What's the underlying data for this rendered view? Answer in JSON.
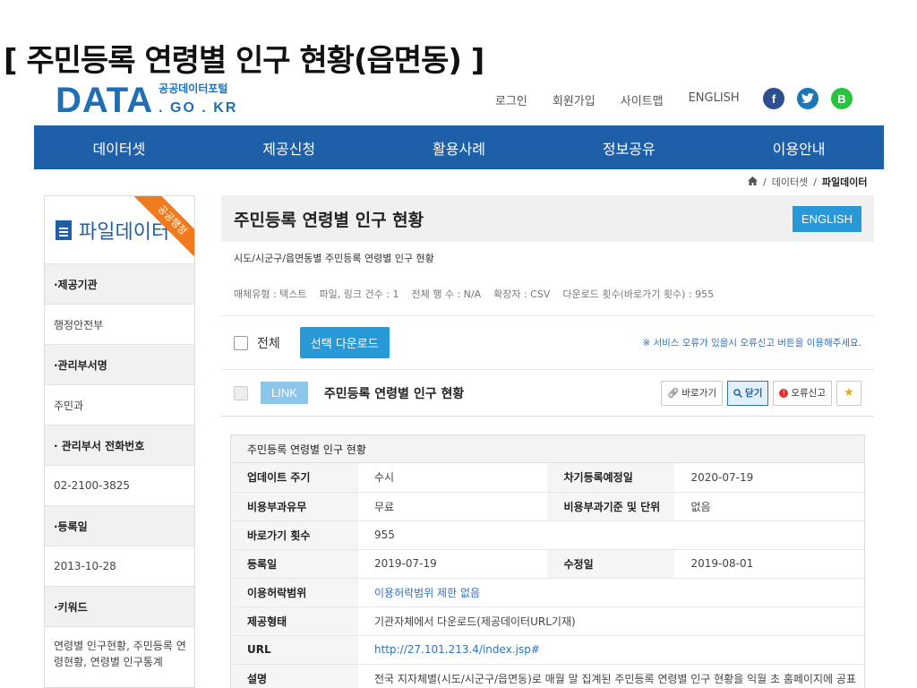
{
  "slide_title": "[ 주민등록 연령별 인구 현황(읍면동) ]",
  "logo": {
    "main": "DATA",
    "korean": "공공데이터포털",
    "domain": ". GO . KR"
  },
  "util_nav": [
    "로그인",
    "회원가입",
    "사이트맵",
    "ENGLISH"
  ],
  "social": {
    "facebook": "f",
    "twitter": "t",
    "blog": "B"
  },
  "main_nav": [
    "데이터셋",
    "제공신청",
    "활용사례",
    "정보공유",
    "이용안내"
  ],
  "breadcrumb": {
    "level1": "데이터셋",
    "current": "파일데이터"
  },
  "sidebar": {
    "header": "파일데이터",
    "ribbon": "공공행정",
    "rows": [
      {
        "label": "·제공기관",
        "value": "행정안전부"
      },
      {
        "label": "·관리부서명",
        "value": "주민과"
      },
      {
        "label": "· 관리부서 전화번호",
        "value": "02-2100-3825"
      },
      {
        "label": "·등록일",
        "value": "2013-10-28"
      },
      {
        "label": "·키워드",
        "value": "연령별 인구현황, 주민등록 연령현황, 연령별 인구통계"
      }
    ]
  },
  "page": {
    "title": "주민등록 연령별 인구 현황",
    "english_button": "ENGLISH",
    "subtitle": "시도/시군구/읍면동별 주민등록 연령별 인구 현황",
    "meta": [
      "매체유형 : 텍스트",
      "파일, 링크 건수 : 1",
      "전체 행 수 : N/A",
      "확장자 : CSV",
      "다운로드 횟수(바로가기 횟수) : 955"
    ]
  },
  "selection": {
    "all_label": "전체",
    "download_button": "선택 다운로드",
    "notice": "※ 서비스 오류가 있을시 오류신고 버튼을 이용해주세요."
  },
  "item": {
    "badge": "LINK",
    "title": "주민등록 연령별 인구 현황",
    "actions": {
      "goto": "바로가기",
      "close": "닫기",
      "report": "오류신고"
    }
  },
  "info": {
    "title": "주민등록 연령별 인구 현황",
    "update_cycle_label": "업데이트 주기",
    "update_cycle": "수시",
    "next_reg_label": "차기등록예정일",
    "next_reg": "2020-07-19",
    "fee_label": "비용부과유무",
    "fee": "무료",
    "fee_basis_label": "비용부과기준 및 단위",
    "fee_basis": "없음",
    "shortcut_label": "바로가기 횟수",
    "shortcut": "955",
    "reg_date_label": "등록일",
    "reg_date": "2019-07-19",
    "mod_date_label": "수정일",
    "mod_date": "2019-08-01",
    "license_label": "이용허락범위",
    "license": "이용허락범위 제한 없음",
    "provide_label": "제공형태",
    "provide": "기관자체에서 다운로드(제공데이터URL기재)",
    "url_label": "URL",
    "url": "http://27.101.213.4/index.jsp#",
    "desc_label": "설명",
    "desc": "전국 지자체별(시도/시군구/읍면동)로 매월 말 집계된 주민등록 연령별 인구 현황을 익월 초 홈페이지에 공표"
  }
}
